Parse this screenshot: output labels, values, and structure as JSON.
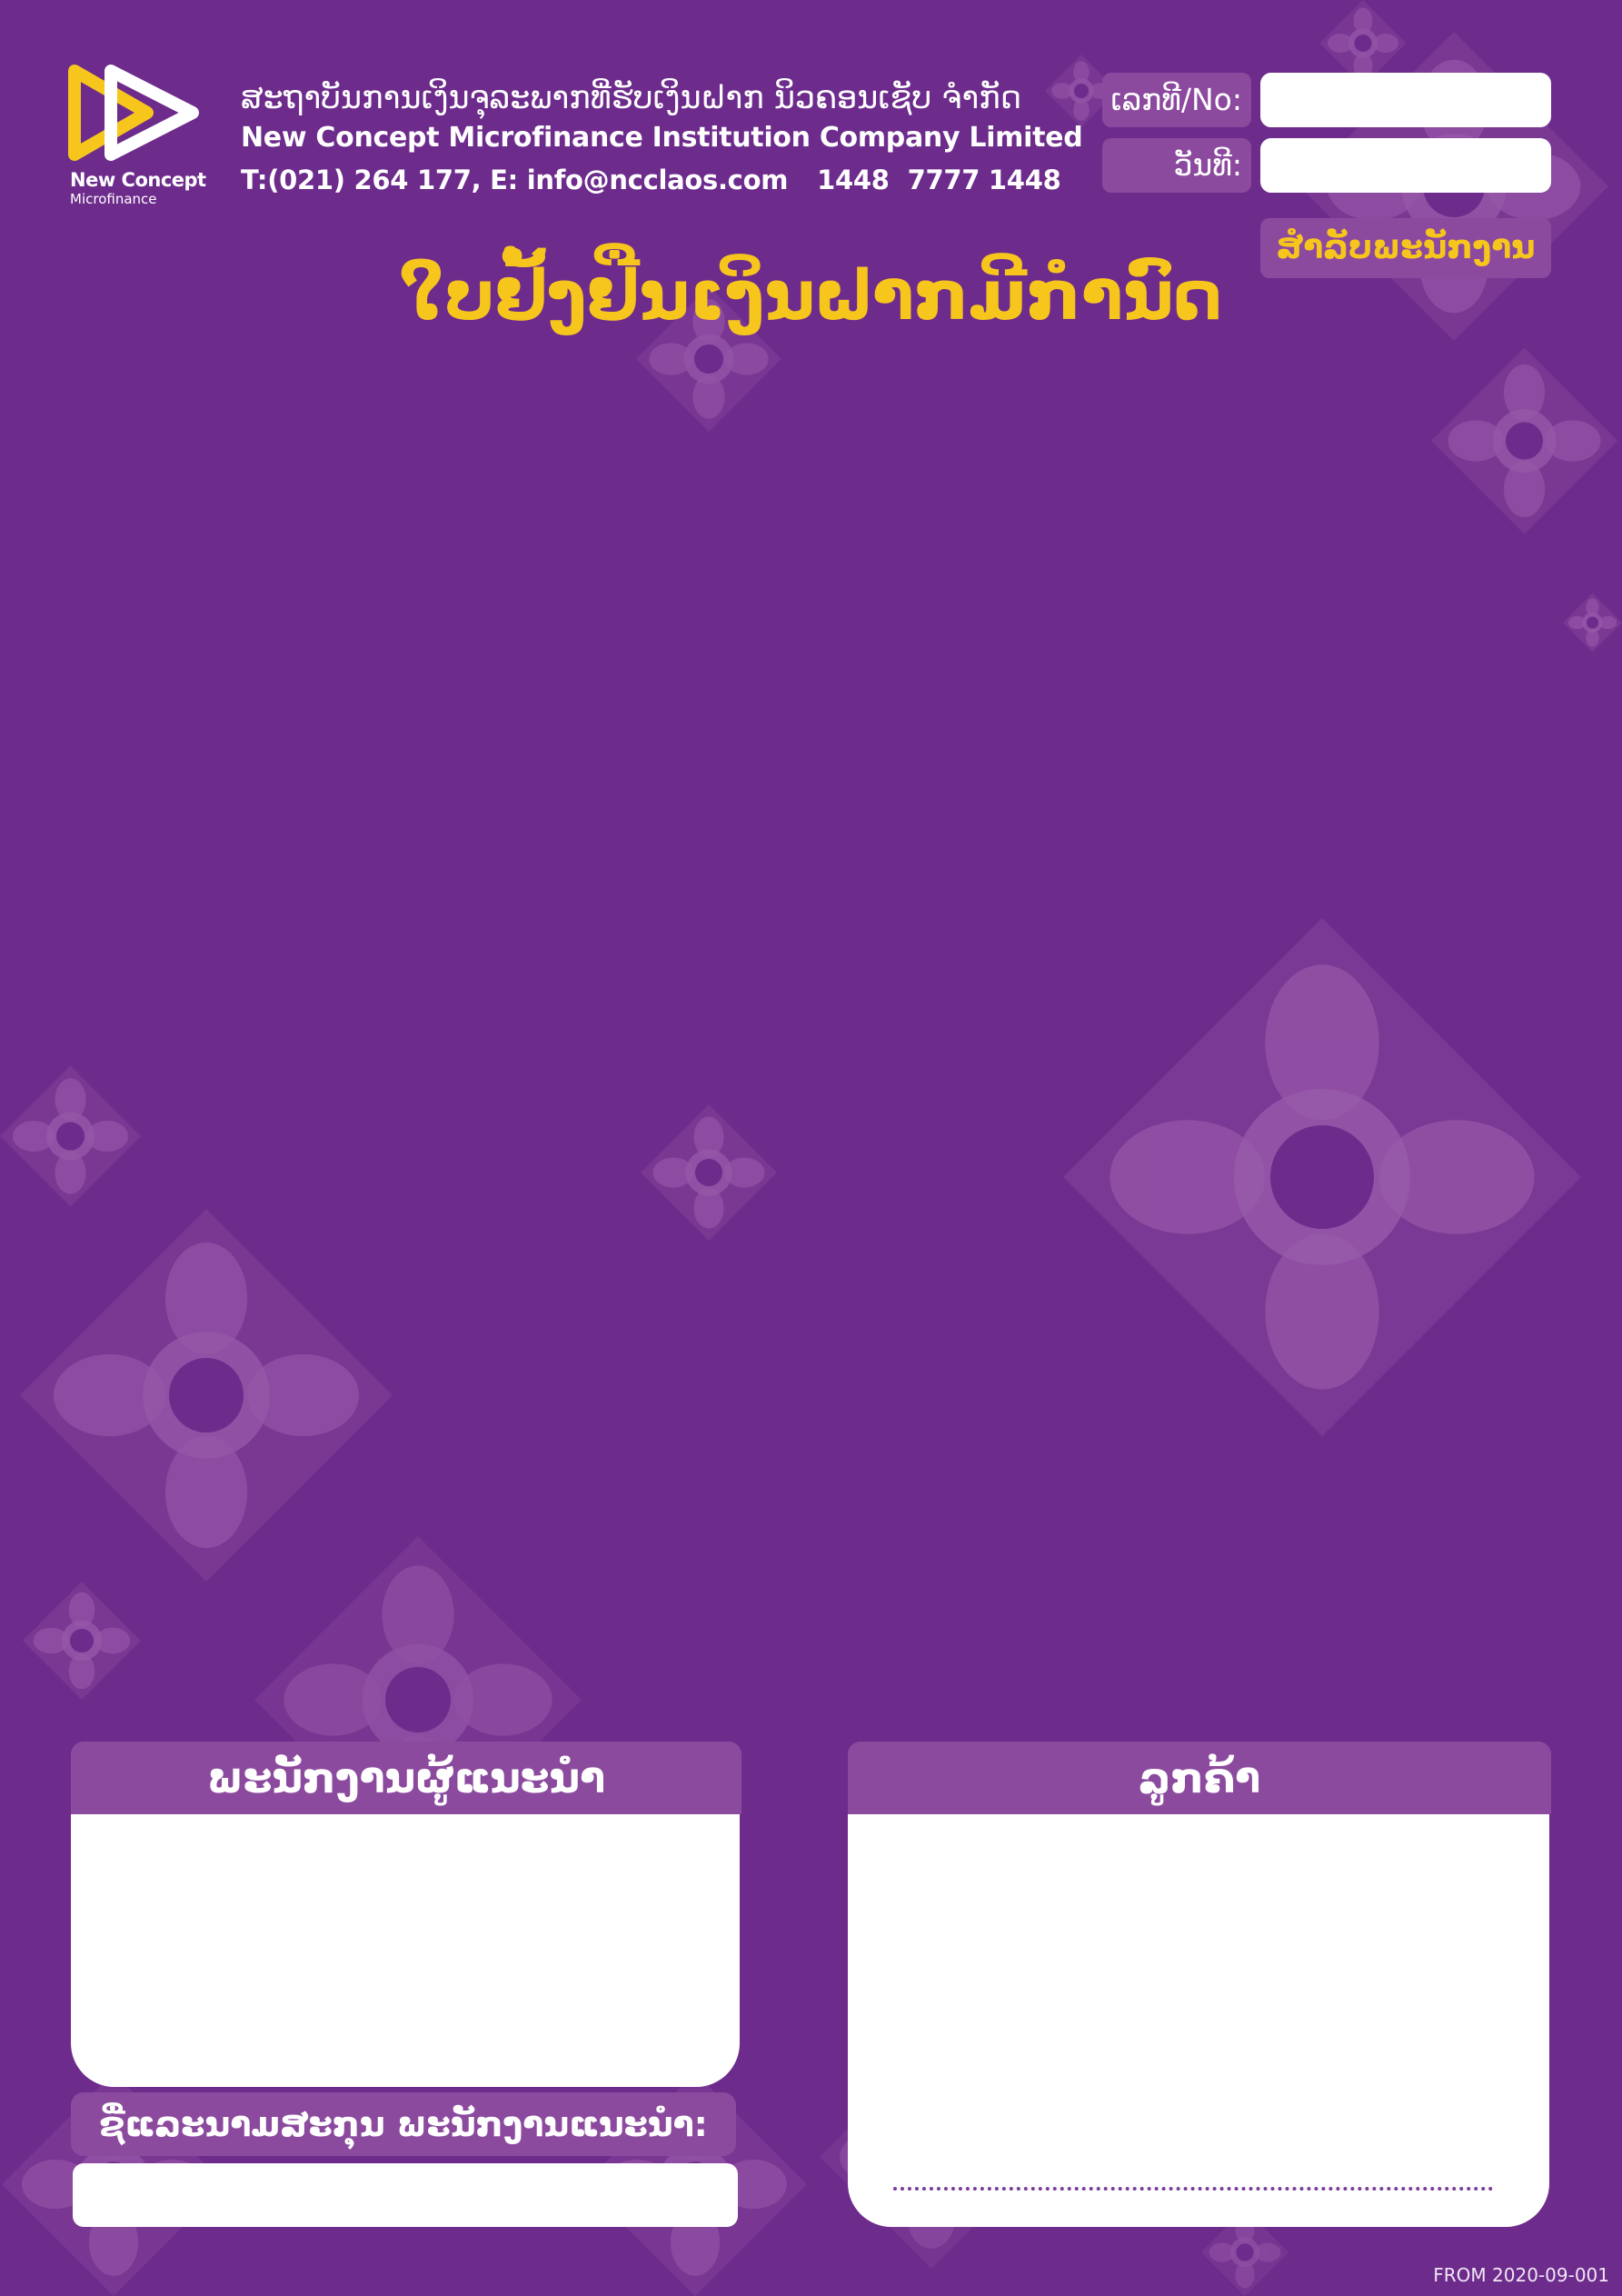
{
  "header": {
    "logo_name": "New Concept",
    "logo_sub": "Microfinance",
    "company_lao": "ສະຖາບັນການເງິນຈຸລະພາກທີ່ຮັບເງິນຝາກ ນິວຄອນເຊັບ ຈຳກັດ",
    "company_en": "New Concept Microfinance Institution Company Limited",
    "contact_main": "T:(021) 264 177, E: info@ncclaos.com",
    "hotline": "1448",
    "whatsapp": "7777 1448",
    "no_label": "ເລກທີ/No:",
    "date_label": "ວັນທີ:",
    "staff_only": "ສຳລັບພະນັກງານ"
  },
  "form_title": "ໃບຢັ້ງຢືນເງິນຝາກມີກຳນົດ",
  "sections": {
    "referrer_title": "ພະນັກງານຜູ້ແນະນຳ",
    "customer_title": "ລູກຄ້າ",
    "referrer_name_label": "ຊື່ແລະນາມສະກຸນ ພະນັກງານແນະນຳ:"
  },
  "footer": {
    "form_code": "FROM 2020-09-001"
  },
  "colors": {
    "background": "#6d2b8c",
    "panel": "#8c4a9f",
    "accent_yellow": "#f7c61d",
    "ornament": "#8c4a9f"
  },
  "icons": {
    "person": "person-icon",
    "whatsapp": "whatsapp-icon",
    "logo": "play-logo-icon",
    "ornament": "lotus-ornament-icon"
  }
}
